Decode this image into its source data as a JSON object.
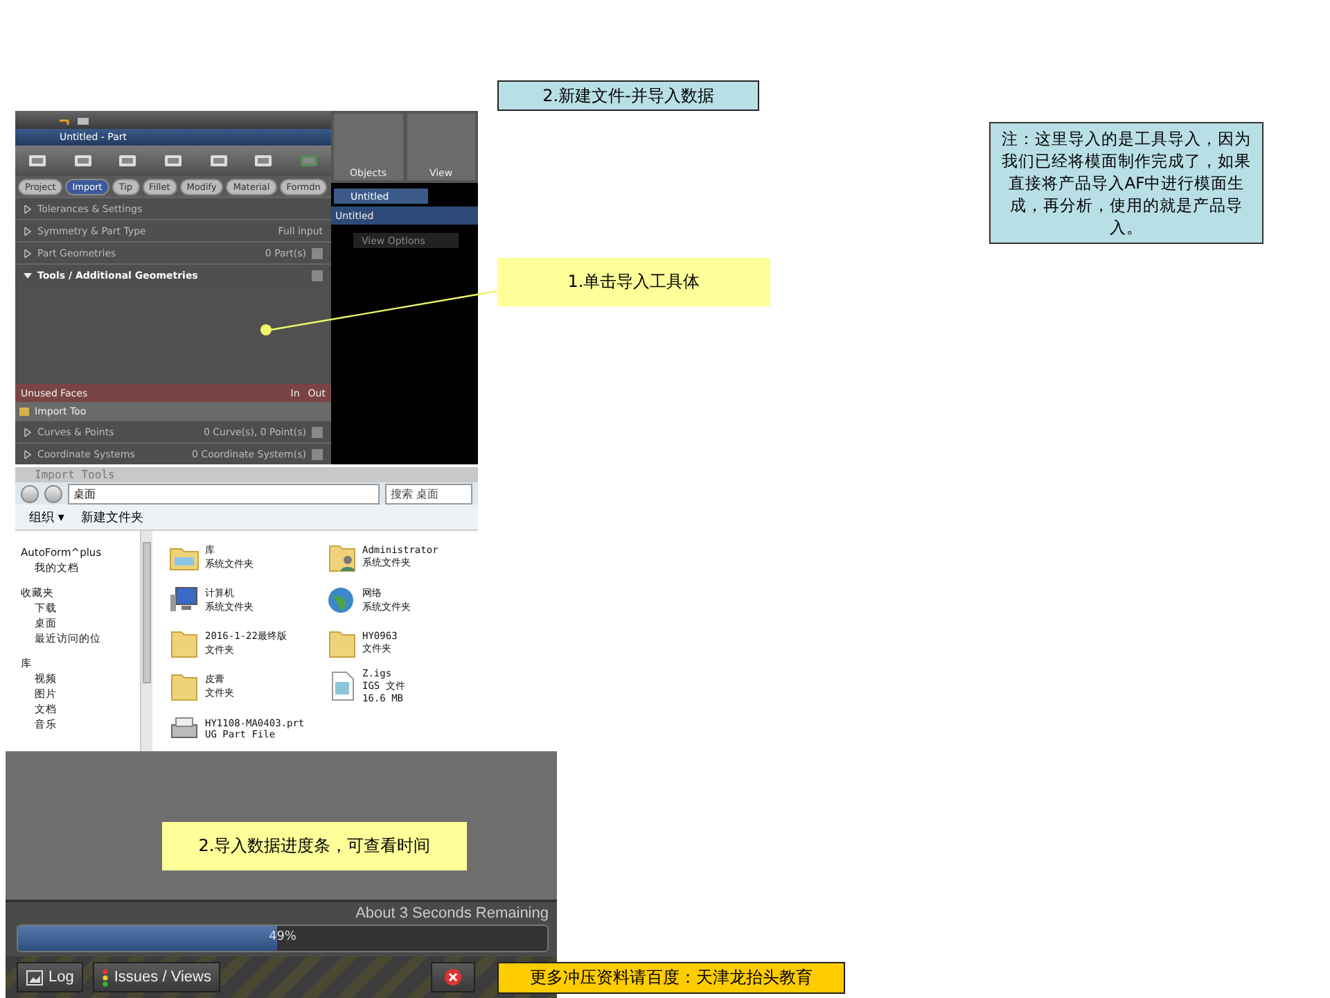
{
  "slide_title": "2.新建文件-并导入数据",
  "note": "注：这里导入的是工具导入，因为我们已经将模面制作完成了，如果直接将产品导入AF中进行模面生成，再分析，使用的就是产品导入。",
  "callouts": [
    {
      "text": "1.单击导入工具体"
    },
    {
      "text": "2.导入数据进度条，可查看时间"
    }
  ],
  "app": {
    "document_title": "Untitled - Part",
    "process_tabs": [
      {
        "label": "Project",
        "selected": false
      },
      {
        "label": "Import",
        "selected": true
      },
      {
        "label": "Tip",
        "selected": false
      },
      {
        "label": "Fillet",
        "selected": false
      },
      {
        "label": "Modify",
        "selected": false
      },
      {
        "label": "Material",
        "selected": false
      },
      {
        "label": "Formdn",
        "selected": false
      }
    ],
    "sections_top": [
      {
        "label": "Tolerances & Settings",
        "expanded": false,
        "toggle": false
      },
      {
        "label": "Symmetry & Part Type",
        "value": "Full input",
        "expanded": false,
        "toggle": false
      },
      {
        "label": "Part Geometries",
        "value": "0 Part(s)",
        "expanded": false,
        "toggle": true
      },
      {
        "label": "Tools / Additional Geometries",
        "expanded": true,
        "toggle": true
      }
    ],
    "unused_faces": {
      "label": "Unused Faces",
      "in": "In",
      "out": "Out"
    },
    "import_tool": "Import Too",
    "sections_bottom": [
      {
        "label": "Curves & Points",
        "value": "0 Curve(s), 0 Point(s)",
        "expanded": false,
        "toggle": true
      },
      {
        "label": "Coordinate Systems",
        "value": "0 Coordinate System(s)",
        "expanded": false,
        "toggle": true
      }
    ],
    "ribbon_groups": [
      "Objects",
      "View"
    ],
    "view_tab": "Untitled",
    "view_title": "Untitled",
    "view_options": "View Options"
  },
  "dialog": {
    "title": "Import Tools",
    "location": "桌面",
    "search": "搜索 桌面",
    "toolbar": [
      "组织 ▾",
      "新建文件夹"
    ],
    "nav": [
      {
        "label": "AutoForm^plus",
        "children": [
          {
            "label": "我的文档"
          }
        ]
      },
      {
        "label": "收藏夹",
        "children": [
          {
            "label": "下载"
          },
          {
            "label": "桌面"
          },
          {
            "label": "最近访问的位"
          }
        ]
      },
      {
        "label": "库",
        "children": [
          {
            "label": "视频"
          },
          {
            "label": "图片"
          },
          {
            "label": "文档"
          },
          {
            "label": "音乐"
          }
        ]
      }
    ],
    "files": [
      {
        "name": "库",
        "type": "系统文件夹",
        "kind": "library"
      },
      {
        "name": "Administrator",
        "type": "系统文件夹",
        "kind": "user"
      },
      {
        "name": "计算机",
        "type": "系统文件夹",
        "kind": "computer"
      },
      {
        "name": "网络",
        "type": "系统文件夹",
        "kind": "network"
      },
      {
        "name": "2016-1-22最终版",
        "type": "文件夹",
        "kind": "folder"
      },
      {
        "name": "HY0963",
        "type": "文件夹",
        "kind": "folder"
      },
      {
        "name": "皮膏",
        "type": "文件夹",
        "kind": "folder"
      },
      {
        "name": "Z.igs",
        "type": "IGS 文件",
        "size": "16.6 MB",
        "kind": "document"
      },
      {
        "name": "HY1108-MA0403.prt",
        "type": "UG Part File",
        "kind": "part"
      }
    ]
  },
  "progress": {
    "remaining": "About 3 Seconds Remaining",
    "percent": "49%",
    "level": 0.49
  },
  "bottom_buttons": [
    "Log",
    "Issues / Views"
  ],
  "footer_ad": "更多冲压资料请百度：天津龙抬头教育"
}
